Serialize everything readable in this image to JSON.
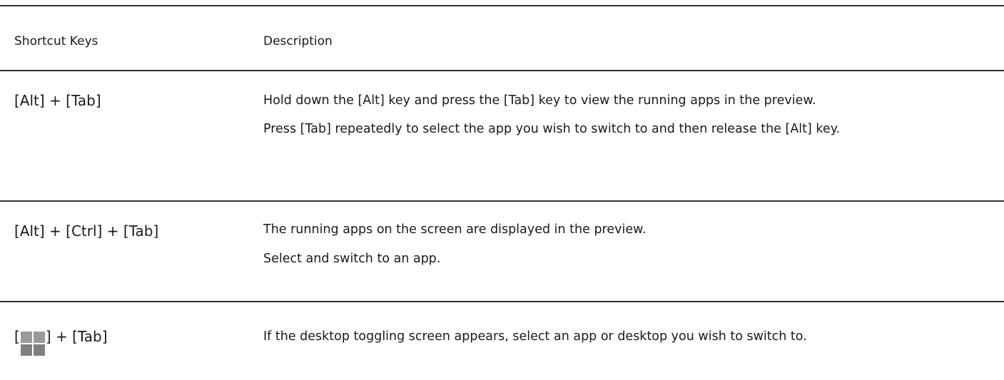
{
  "table": {
    "header": {
      "keys": "Shortcut Keys",
      "description": "Description"
    },
    "rows": [
      {
        "keys": "[Alt] + [Tab]",
        "description": [
          "Hold down the [Alt] key and press the [Tab] key to view the running apps in the preview.",
          "Press [Tab] repeatedly to select the app you wish to switch to and then release the [Alt] key."
        ]
      },
      {
        "keys": "[Alt] + [Ctrl] + [Tab]",
        "description": [
          "The running apps on the screen are displayed in the preview.",
          "Select and switch to an app."
        ]
      },
      {
        "keys_prefix": "[",
        "keys_icon": "windows-key-icon",
        "keys_suffix": "] + [Tab]",
        "description": [
          "If the desktop toggling screen appears, select an app or desktop you wish to switch to."
        ]
      }
    ]
  }
}
